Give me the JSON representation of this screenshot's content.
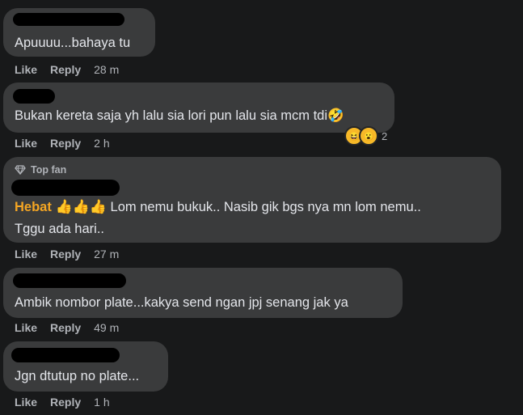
{
  "comments": [
    {
      "text": "Apuuuu...bahaya tu",
      "like": "Like",
      "reply": "Reply",
      "time": "28 m"
    },
    {
      "text": "Bukan kereta saja yh lalu sia lori pun lalu sia mcm tdi🤣",
      "like": "Like",
      "reply": "Reply",
      "time": "2 h",
      "reaction_count": "2",
      "reaction_icons": [
        "laughing-emoji",
        "wow-emoji"
      ]
    },
    {
      "badge": "Top fan",
      "badge_icon": "diamond-icon",
      "highlight": "Hebat",
      "emoji": "👍👍👍",
      "text1": "Lom nemu bukuk.. Nasib gik bgs nya mn lom nemu..",
      "text2": "Tggu ada hari..",
      "like": "Like",
      "reply": "Reply",
      "time": "27 m"
    },
    {
      "text": "Ambik nombor plate...kakya send ngan jpj senang jak ya",
      "like": "Like",
      "reply": "Reply",
      "time": "49 m"
    },
    {
      "text": "Jgn dtutup no plate...",
      "like": "Like",
      "reply": "Reply",
      "time": "1 h"
    }
  ],
  "colors": {
    "background": "#18191a",
    "bubble": "#3a3b3c",
    "text": "#e4e6eb",
    "muted": "#b0b3b8",
    "highlight": "#f5a623"
  }
}
